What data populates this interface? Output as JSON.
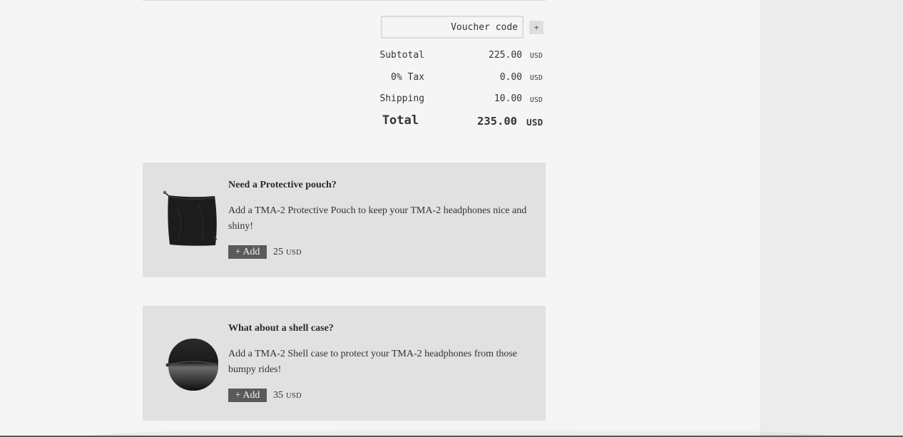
{
  "voucher": {
    "placeholder": "Voucher code",
    "add_label": "+"
  },
  "summary": {
    "rows": [
      {
        "label": "Subtotal",
        "value": "225.00",
        "currency": "USD"
      },
      {
        "label": "0% Tax",
        "value": "0.00",
        "currency": "USD"
      },
      {
        "label": "Shipping",
        "value": "10.00",
        "currency": "USD"
      }
    ],
    "total": {
      "label": "Total",
      "value": "235.00",
      "currency": "USD"
    }
  },
  "upsells": [
    {
      "title": "Need a Protective pouch?",
      "description": "Add a TMA-2 Protective Pouch to keep your TMA-2 headphones nice and shiny!",
      "add_label": "+ Add",
      "price": "25",
      "currency": "USD",
      "image_icon": "protective-pouch-image"
    },
    {
      "title": "What about a shell case?",
      "description": "Add a TMA-2 Shell case to protect your TMA-2 headphones from those bumpy rides!",
      "add_label": "+ Add",
      "price": "35",
      "currency": "USD",
      "image_icon": "shell-case-image"
    }
  ],
  "colors": {
    "background": "#f5f5f5",
    "card_background": "#e1e1e1",
    "button_background": "#5a5a5a",
    "side_panel": "#ececec"
  }
}
